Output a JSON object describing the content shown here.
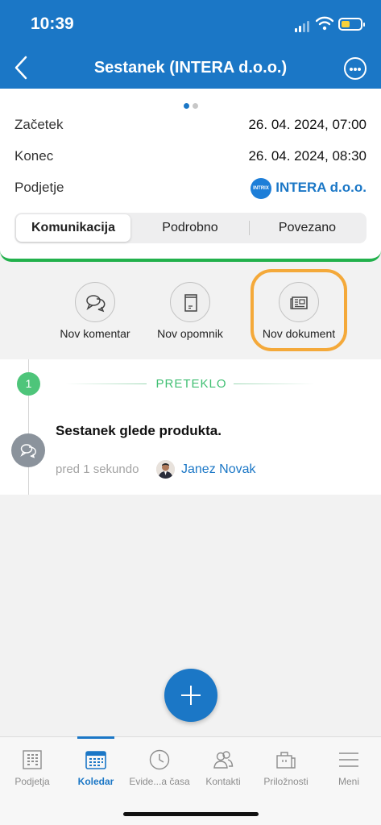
{
  "status_bar": {
    "time": "10:39"
  },
  "nav": {
    "title": "Sestanek (INTERA d.o.o.)",
    "back_icon": "chevron-left-icon",
    "more_icon": "more-horizontal-icon"
  },
  "details": {
    "start_label": "Začetek",
    "start_value": "26. 04. 2024, 07:00",
    "end_label": "Konec",
    "end_value": "26. 04. 2024, 08:30",
    "company_label": "Podjetje",
    "company_logo_text": "INTRIX",
    "company_value": "INTERA d.o.o."
  },
  "segments": [
    "Komunikacija",
    "Podrobno",
    "Povezano"
  ],
  "actions": [
    {
      "label": "Nov komentar",
      "icon": "chat-bubbles-icon"
    },
    {
      "label": "Nov opomnik",
      "icon": "reminder-note-icon"
    },
    {
      "label": "Nov dokument",
      "icon": "newspaper-document-icon"
    }
  ],
  "timeline": {
    "badge": "1",
    "heading": "PRETEKLO",
    "entry_text": "Sestanek glede produkta.",
    "entry_time": "pred 1 sekundo",
    "entry_user": "Janez Novak"
  },
  "tabs": [
    {
      "label": "Podjetja",
      "icon": "building-icon"
    },
    {
      "label": "Koledar",
      "icon": "calendar-icon"
    },
    {
      "label": "Evide...a časa",
      "icon": "clock-icon"
    },
    {
      "label": "Kontakti",
      "icon": "contacts-icon"
    },
    {
      "label": "Priložnosti",
      "icon": "briefcase-icon"
    },
    {
      "label": "Meni",
      "icon": "menu-icon"
    }
  ],
  "colors": {
    "primary": "#1b77c6",
    "accent_green": "#22b14c",
    "highlight_orange": "#f4a93a"
  }
}
